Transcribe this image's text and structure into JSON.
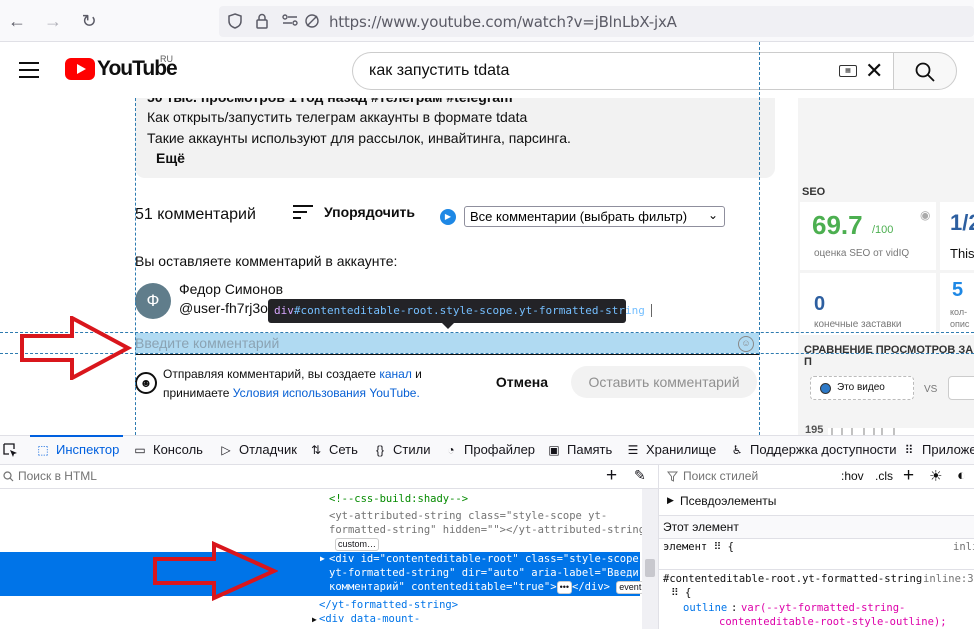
{
  "browser": {
    "url": "https://www.youtube.com/watch?v=jBlnLbX-jxA"
  },
  "youtube": {
    "logo_text": "YouTube",
    "region": "RU",
    "search_query": "как запустить tdata",
    "description": {
      "line0": "50 тыс. просмотров  1 год назад  #телеграм #telegram",
      "line1": "Как открыть/запустить телеграм аккаунты в формате tdata",
      "line2": "Такие аккаунты используют для рассылок, инвайтинга, парсинга.",
      "more": "Ещё"
    },
    "comments": {
      "count_label": "51 комментарий",
      "sort_label": "Упорядочить",
      "filter_value": "Все комментарии (выбрать фильтр)",
      "leaving_as": "Вы оставляете комментарий в аккаунте:",
      "avatar_letter": "Ф",
      "user_name": "Федор Симонов",
      "user_handle": "@user-fh7rj3o",
      "placeholder": "Введите комментарий",
      "notice_pre": "Отправляя комментарий, вы создаете",
      "notice_link1": "канал",
      "notice_mid": "и принимаете",
      "notice_link2": "Условия использования YouTube.",
      "cancel": "Отмена",
      "submit": "Оставить комментарий"
    },
    "vidiq": {
      "seo_title": "SEO",
      "seo_score": "69.7",
      "seo_max": "/100",
      "seo_label": "оценка SEO от vidIQ",
      "partial_value": "1/2",
      "partial_word": "This",
      "end_screens_value": "0",
      "end_screens_label": "конечные заставки",
      "right_value": "5",
      "right_label1": "кол-",
      "right_label2": "опис",
      "compare_title": "СРАВНЕНИЕ ПРОСМОТРОВ ЗА П",
      "this_video": "Это видео",
      "vs": "VS",
      "chart_tick": "195"
    }
  },
  "inspector_tooltip": {
    "tag": "div",
    "selector": "#contenteditable-root.style-scope.yt-formatted-string",
    "size": "624 × 20"
  },
  "devtools": {
    "tabs": {
      "inspector": "Инспектор",
      "console": "Консоль",
      "debugger": "Отладчик",
      "network": "Сеть",
      "styles": "Стили",
      "profiler": "Профайлер",
      "memory": "Память",
      "storage": "Хранилище",
      "accessibility": "Поддержка доступности",
      "apps": "Приложе"
    },
    "html_search_placeholder": "Поиск в HTML",
    "styles_search_placeholder": "Поиск стилей",
    "hov": ":hov",
    "cls": ".cls",
    "markup": {
      "l1": "<!--css-build:shady-->",
      "l2a": "<yt-attributed-string class=\"style-scope yt-",
      "l2b": "formatted-string\" hidden=\"\"></yt-attributed-string>",
      "l2badge": "custom…",
      "sel1": "<div id=\"contenteditable-root\" class=\"style-scope",
      "sel2": "yt-formatted-string\" dir=\"auto\" aria-label=\"Введите",
      "sel3": "комментарий\" contenteditable=\"true\">",
      "sel3b": "</div>",
      "event_badge": "event",
      "dots_badge": "•••",
      "l4": "</yt-formatted-string>",
      "l5": "<div data-mount-"
    },
    "rules": {
      "pseudo": "Псевдоэлементы",
      "this_element": "Этот элемент",
      "element_rule": "элемент ⠿ {",
      "element_source": "inli",
      "selector": "#contenteditable-root.yt-formatted-string",
      "selector_source": "inline:37",
      "brace": "⠿ {",
      "prop": "outline",
      "val1": "var(--yt-formatted-string-",
      "val2": "contenteditable-root-style-outline);"
    }
  },
  "colors": {
    "youtube_red": "#ff0000",
    "link_blue": "#065fd4",
    "devtools_blue": "#0074e8",
    "highlight": "#6fbce8",
    "arrow_red": "#d9161c",
    "vidiq_green": "#4caf50",
    "vidiq_blue": "#2d5fa0"
  }
}
